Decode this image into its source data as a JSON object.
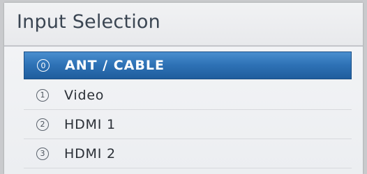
{
  "menu": {
    "title": "Input Selection",
    "items": [
      {
        "number": "0",
        "label": "ANT / CABLE",
        "selected": true
      },
      {
        "number": "1",
        "label": "Video",
        "selected": false
      },
      {
        "number": "2",
        "label": "HDMI 1",
        "selected": false
      },
      {
        "number": "3",
        "label": "HDMI 2",
        "selected": false
      }
    ]
  },
  "colors": {
    "selected_bg": "#2f73b7",
    "panel_bg": "#f1f2f4",
    "text": "#2a2f36"
  }
}
